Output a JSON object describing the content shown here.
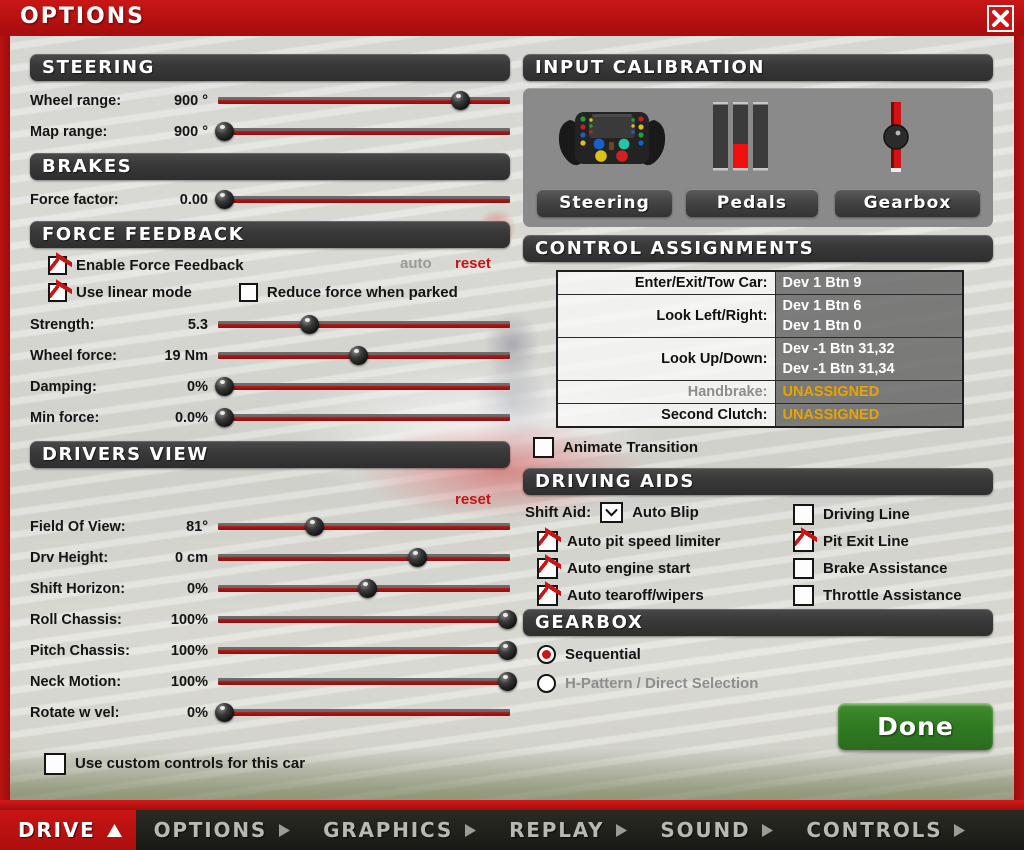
{
  "window": {
    "title": "OPTIONS",
    "close_icon": "close-x-icon"
  },
  "steering": {
    "header": "STEERING",
    "sliders": [
      {
        "label": "Wheel range:",
        "value": "900 °",
        "pct": 83
      },
      {
        "label": "Map range:",
        "value": "900 °",
        "pct": 2
      }
    ]
  },
  "brakes": {
    "header": "BRAKES",
    "sliders": [
      {
        "label": "Force factor:",
        "value": "0.00",
        "pct": 2
      }
    ]
  },
  "force_feedback": {
    "header": "FORCE FEEDBACK",
    "auto_label": "auto",
    "reset_label": "reset",
    "checkboxes": [
      {
        "label": "Enable Force Feedback",
        "checked": true
      },
      {
        "label": "Use linear mode",
        "checked": true
      },
      {
        "label": "Reduce force when parked",
        "checked": false
      }
    ],
    "sliders": [
      {
        "label": "Strength:",
        "value": "5.3",
        "pct": 31
      },
      {
        "label": "Wheel force:",
        "value": "19 Nm",
        "pct": 48
      },
      {
        "label": "Damping:",
        "value": "0%",
        "pct": 2
      },
      {
        "label": "Min force:",
        "value": "0.0%",
        "pct": 2
      }
    ]
  },
  "drivers_view": {
    "header": "DRIVERS VIEW",
    "reset_label": "reset",
    "sliders": [
      {
        "label": "Field Of View:",
        "value": "81°",
        "pct": 33
      },
      {
        "label": "Drv Height:",
        "value": "0 cm",
        "pct": 68
      },
      {
        "label": "Shift Horizon:",
        "value": "0%",
        "pct": 51
      },
      {
        "label": "Roll Chassis:",
        "value": "100%",
        "pct": 99
      },
      {
        "label": "Pitch Chassis:",
        "value": "100%",
        "pct": 99
      },
      {
        "label": "Neck Motion:",
        "value": "100%",
        "pct": 99
      },
      {
        "label": "Rotate w vel:",
        "value": "0%",
        "pct": 2
      }
    ]
  },
  "custom_controls": {
    "label": "Use custom controls for this car",
    "checked": false
  },
  "input_calibration": {
    "header": "INPUT CALIBRATION",
    "buttons": [
      {
        "label": "Steering",
        "icon": "steering-wheel-icon"
      },
      {
        "label": "Pedals",
        "icon": "pedal-bars-icon"
      },
      {
        "label": "Gearbox",
        "icon": "gear-lever-icon"
      }
    ],
    "pedals": {
      "clutch_pct": 0,
      "brake_pct": 36,
      "throttle_pct": 0
    }
  },
  "control_assignments": {
    "header": "CONTROL ASSIGNMENTS",
    "rows": [
      {
        "label": "Enter/Exit/Tow Car:",
        "value": "Dev 1 Btn 9",
        "dim": false,
        "unassigned": false
      },
      {
        "label": "Look Left/Right:",
        "value": "Dev 1 Btn 6\nDev 1 Btn 0",
        "dim": false,
        "unassigned": false
      },
      {
        "label": "Look Up/Down:",
        "value": "Dev -1 Btn 31,32\nDev -1 Btn 31,34",
        "dim": false,
        "unassigned": false
      },
      {
        "label": "Handbrake:",
        "value": "UNASSIGNED",
        "dim": true,
        "unassigned": true
      },
      {
        "label": "Second Clutch:",
        "value": "UNASSIGNED",
        "dim": false,
        "unassigned": true
      }
    ],
    "animate_transition": {
      "label": "Animate Transition",
      "checked": false
    }
  },
  "driving_aids": {
    "header": "DRIVING AIDS",
    "shift_aid_label": "Shift Aid:",
    "shift_aid_value": "Auto Blip",
    "left_items": [
      {
        "label": "Auto pit speed limiter",
        "checked": true
      },
      {
        "label": "Auto engine start",
        "checked": true
      },
      {
        "label": "Auto tearoff/wipers",
        "checked": true
      }
    ],
    "right_items": [
      {
        "label": "Driving Line",
        "checked": false
      },
      {
        "label": "Pit Exit Line",
        "checked": true
      },
      {
        "label": "Brake Assistance",
        "checked": false
      },
      {
        "label": "Throttle Assistance",
        "checked": false
      }
    ]
  },
  "gearbox": {
    "header": "GEARBOX",
    "options": [
      {
        "label": "Sequential",
        "selected": true,
        "dim": false
      },
      {
        "label": "H-Pattern / Direct Selection",
        "selected": false,
        "dim": true
      }
    ]
  },
  "done_button": {
    "label": "Done"
  },
  "nav": {
    "items": [
      {
        "label": "DRIVE",
        "active": true,
        "marker": "up-triangle-icon"
      },
      {
        "label": "OPTIONS",
        "active": false,
        "marker": "right-triangle-icon"
      },
      {
        "label": "GRAPHICS",
        "active": false,
        "marker": "right-triangle-icon"
      },
      {
        "label": "REPLAY",
        "active": false,
        "marker": "right-triangle-icon"
      },
      {
        "label": "SOUND",
        "active": false,
        "marker": "right-triangle-icon"
      },
      {
        "label": "CONTROLS",
        "active": false,
        "marker": "right-triangle-icon"
      }
    ]
  },
  "colors": {
    "accent_red": "#c21616",
    "title_red": "#b71111",
    "header_dark": "#333333",
    "done_green": "#2f7a22",
    "unassigned_amber": "#e8a400"
  }
}
